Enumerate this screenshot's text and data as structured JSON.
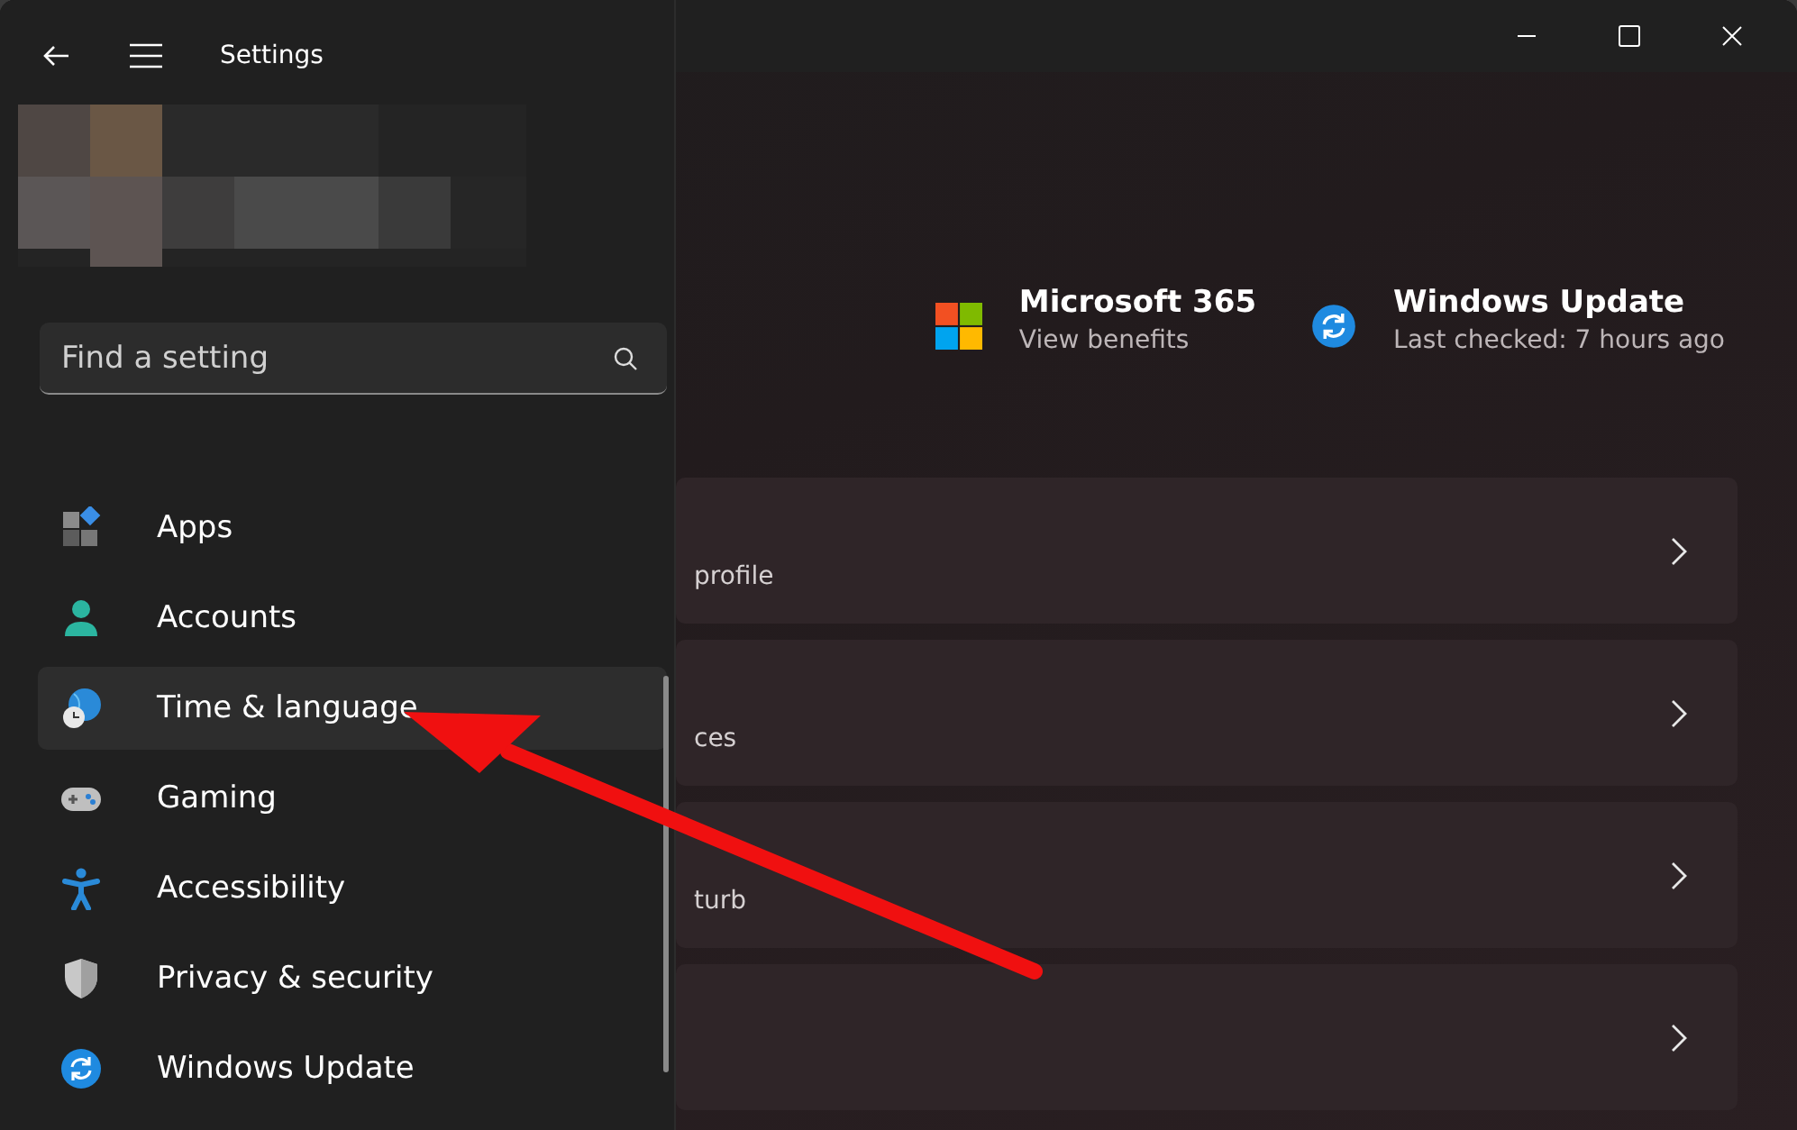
{
  "window": {
    "title": "Settings"
  },
  "search": {
    "placeholder": "Find a setting"
  },
  "nav_items": [
    {
      "kind": "apps",
      "label": "Apps",
      "selected": false
    },
    {
      "kind": "accounts",
      "label": "Accounts",
      "selected": false
    },
    {
      "kind": "time",
      "label": "Time & language",
      "selected": true
    },
    {
      "kind": "gaming",
      "label": "Gaming",
      "selected": false
    },
    {
      "kind": "accessibility",
      "label": "Accessibility",
      "selected": false
    },
    {
      "kind": "privacy",
      "label": "Privacy & security",
      "selected": false
    },
    {
      "kind": "update",
      "label": "Windows Update",
      "selected": false
    }
  ],
  "header_tiles": [
    {
      "kind": "microsoft365",
      "title": "Microsoft 365",
      "subtitle": "View benefits"
    },
    {
      "kind": "update",
      "title": "Windows Update",
      "subtitle": "Last checked: 7 hours ago"
    }
  ],
  "cards": [
    {
      "kind": "link",
      "subtitle": "profile"
    },
    {
      "kind": "link",
      "subtitle": "ces"
    },
    {
      "kind": "link",
      "subtitle": "turb"
    },
    {
      "kind": "link"
    }
  ]
}
